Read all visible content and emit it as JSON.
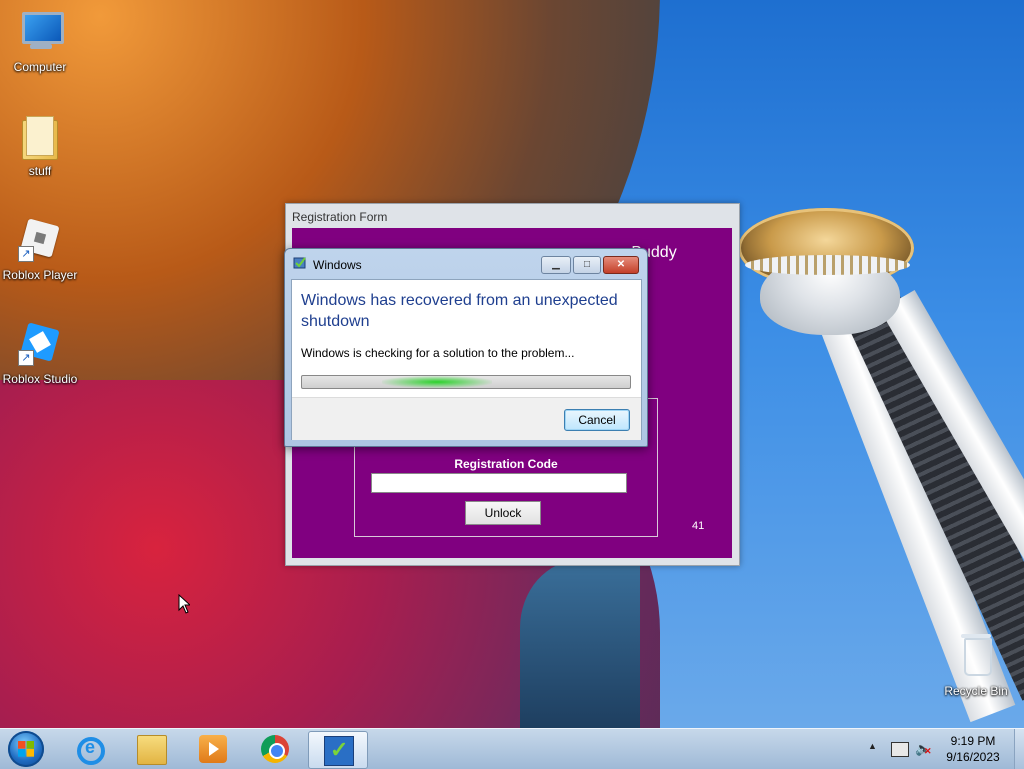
{
  "desktop": {
    "icons": [
      {
        "label": "Computer",
        "icon": "computer-icon"
      },
      {
        "label": "stuff",
        "icon": "folder-icon"
      },
      {
        "label": "Roblox Player",
        "icon": "roblox-player-icon"
      },
      {
        "label": "Roblox Studio",
        "icon": "roblox-studio-icon"
      },
      {
        "label": "Recycle Bin",
        "icon": "recycle-bin-icon"
      }
    ]
  },
  "registration_window": {
    "title": "Registration Form",
    "brand_text": "rBuddy",
    "code_label": "Registration Code",
    "code_value": "",
    "unlock_label": "Unlock",
    "counter": "41",
    "background_color": "#800080"
  },
  "error_dialog": {
    "title": "Windows",
    "heading": "Windows has recovered from an unexpected shutdown",
    "message": "Windows is checking for a solution to the problem...",
    "cancel_label": "Cancel",
    "progress_state": "indeterminate",
    "caption_buttons": {
      "minimize": "minimize-icon",
      "maximize": "maximize-icon",
      "close": "close-icon"
    }
  },
  "taskbar": {
    "pinned": [
      {
        "name": "internet-explorer",
        "icon": "internet-explorer-icon"
      },
      {
        "name": "windows-explorer",
        "icon": "folder-icon"
      },
      {
        "name": "media-player",
        "icon": "media-player-icon"
      },
      {
        "name": "chrome",
        "icon": "chrome-icon"
      },
      {
        "name": "registration-app",
        "icon": "registration-app-icon",
        "active": true
      }
    ],
    "clock": {
      "time": "9:19 PM",
      "date": "9/16/2023"
    },
    "tray": [
      "show-hidden-icons",
      "network-icon",
      "volume-muted-icon"
    ]
  }
}
